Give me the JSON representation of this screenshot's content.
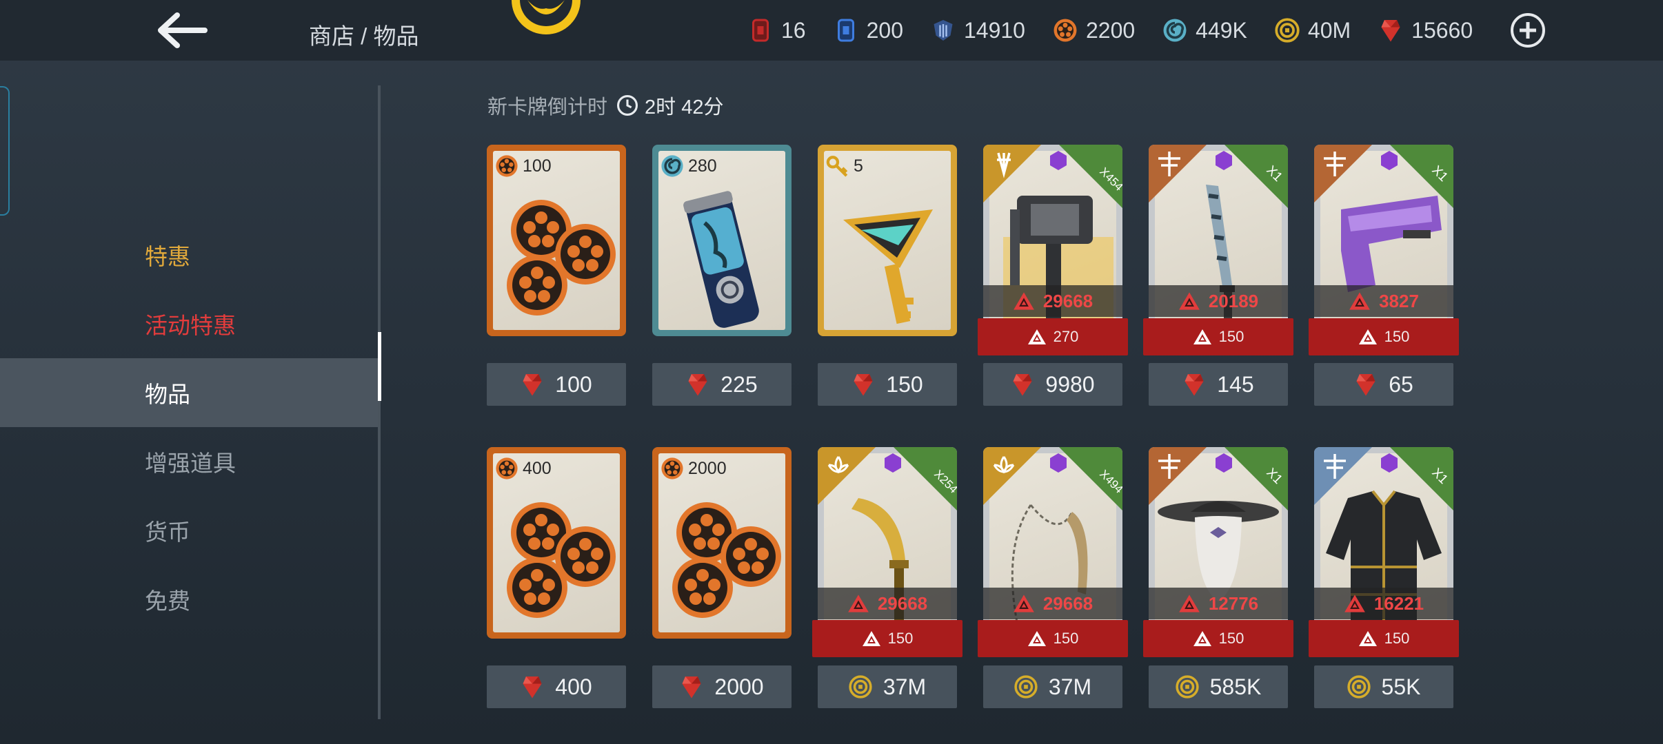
{
  "header": {
    "breadcrumb": "商店 / 物品",
    "resources": [
      {
        "icon": "red-card-icon",
        "value": "16"
      },
      {
        "icon": "blue-card-icon",
        "value": "200"
      },
      {
        "icon": "blue-shield-icon",
        "value": "14910"
      },
      {
        "icon": "orange-token-icon",
        "value": "2200"
      },
      {
        "icon": "teal-swirl-icon",
        "value": "449K"
      },
      {
        "icon": "gold-coin-icon",
        "value": "40M"
      },
      {
        "icon": "red-gem-icon",
        "value": "15660"
      }
    ]
  },
  "sidebar": {
    "items": [
      {
        "label": "特惠",
        "state": "highlight-gold"
      },
      {
        "label": "活动特惠",
        "state": "highlight-red"
      },
      {
        "label": "物品",
        "state": "active"
      },
      {
        "label": "增强道具",
        "state": "normal"
      },
      {
        "label": "货币",
        "state": "normal"
      },
      {
        "label": "免费",
        "state": "normal"
      }
    ]
  },
  "timer": {
    "label": "新卡牌倒计时",
    "value": "2时 42分"
  },
  "row1": [
    {
      "type": "orange-tokens",
      "qty": "100",
      "price": "100",
      "currency": "gem"
    },
    {
      "type": "teal-capsule",
      "qty": "280",
      "price": "225",
      "currency": "gem"
    },
    {
      "type": "gold-key",
      "qty": "5",
      "price": "150",
      "currency": "gem"
    },
    {
      "type": "gear-hammer",
      "count": "X454",
      "power": "29668",
      "bar": "270",
      "price": "9980",
      "currency": "gem"
    },
    {
      "type": "gear-sword",
      "count": "X1",
      "power": "20189",
      "bar": "150",
      "price": "145",
      "currency": "gem"
    },
    {
      "type": "gear-gun",
      "count": "X1",
      "power": "3827",
      "bar": "150",
      "price": "65",
      "currency": "gem"
    }
  ],
  "row2": [
    {
      "type": "orange-tokens",
      "qty": "400",
      "price": "400",
      "currency": "gem"
    },
    {
      "type": "orange-tokens",
      "qty": "2000",
      "price": "2000",
      "currency": "gem"
    },
    {
      "type": "gear-blade",
      "count": "X254",
      "power": "29668",
      "bar": "150",
      "price": "37M",
      "currency": "coin"
    },
    {
      "type": "gear-chain",
      "count": "X494",
      "power": "29668",
      "bar": "150",
      "price": "37M",
      "currency": "coin"
    },
    {
      "type": "gear-mask",
      "count": "X1",
      "power": "12776",
      "bar": "150",
      "price": "585K",
      "currency": "coin"
    },
    {
      "type": "gear-armor",
      "count": "X1",
      "power": "16221",
      "bar": "150",
      "price": "55K",
      "currency": "coin"
    }
  ],
  "colors": {
    "accent_gold": "#e1a93b",
    "accent_red": "#e23c3c",
    "bar_red": "#a91c1c",
    "power_red": "#ee4747"
  }
}
